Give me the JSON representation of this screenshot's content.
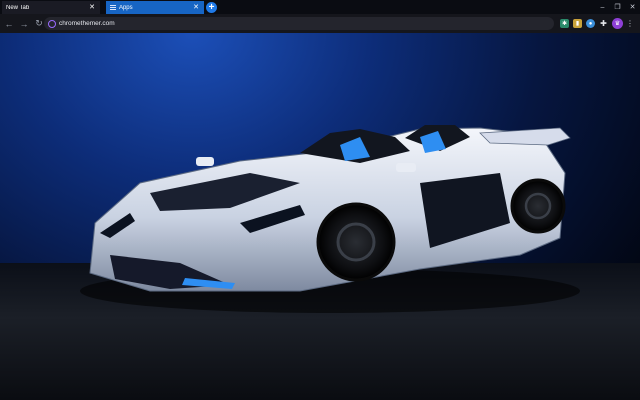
{
  "browser": {
    "tabs": [
      {
        "label": "New Tab",
        "active": true,
        "close": "✕"
      },
      {
        "label": "Apps",
        "active": false,
        "close": "✕"
      }
    ],
    "new_tab_glyph": "+",
    "window_controls": {
      "minimize": "–",
      "maximize": "❐",
      "close": "✕"
    },
    "nav": {
      "back": "←",
      "forward": "→",
      "reload": "↻"
    },
    "omnibox": {
      "url": "chromethemer.com"
    },
    "extensions": [
      {
        "name": "extension-puzzle-icon",
        "glyph": "✱"
      },
      {
        "name": "extension-a-icon",
        "glyph": "▮"
      },
      {
        "name": "extension-b-icon",
        "glyph": "●"
      },
      {
        "name": "extensions-menu-icon",
        "glyph": "✚"
      }
    ],
    "avatar_glyph": "♛",
    "menu_glyph": "⋮"
  },
  "colors": {
    "tab_active": "#1a1b24",
    "tab_inactive": "#1765c4",
    "toolbar": "#15161c",
    "omnibox": "#24252d",
    "accent": "#9b6bff",
    "backdrop_blue": "#1c4fb8"
  },
  "background": {
    "subject": "white-and-blue-supercar-roadster"
  }
}
